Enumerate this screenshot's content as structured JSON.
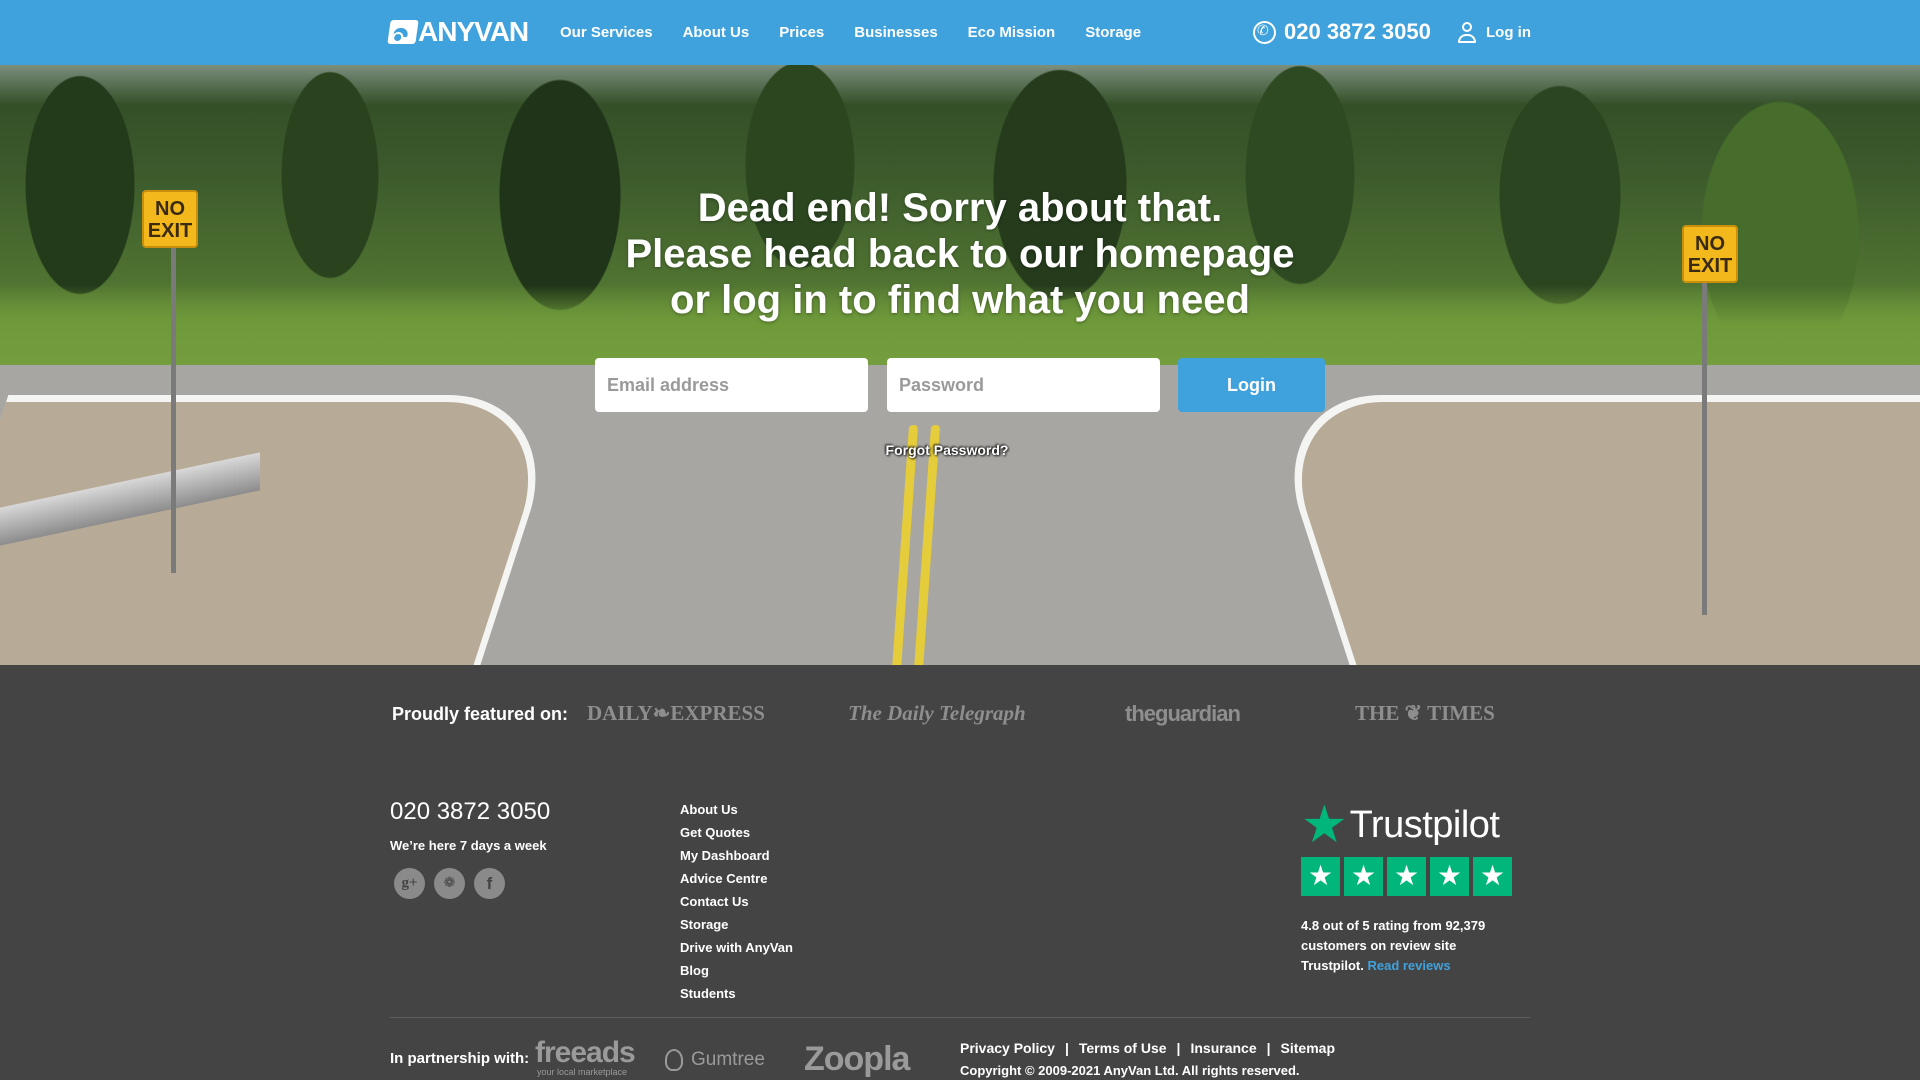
{
  "header": {
    "logo_text": "ANYVAN",
    "nav": [
      {
        "label": "Our Services"
      },
      {
        "label": "About Us"
      },
      {
        "label": "Prices"
      },
      {
        "label": "Businesses"
      },
      {
        "label": "Eco Mission"
      },
      {
        "label": "Storage"
      }
    ],
    "phone": "020 3872 3050",
    "login_label": "Log in",
    "accent_color": "#3fa2dd"
  },
  "hero": {
    "title_lines": [
      "Dead end! Sorry about that.",
      "Please head back to our homepage",
      "or log in to find what you need"
    ],
    "sign_text": [
      "NO",
      "EXIT"
    ],
    "email_placeholder": "Email address",
    "email_value": "",
    "password_placeholder": "Password",
    "password_value": "",
    "login_button": "Login",
    "forgot_password": "Forgot Password?"
  },
  "footer": {
    "featured_label": "Proudly featured on:",
    "press": [
      "DAILY❧EXPRESS",
      "The Daily Telegraph",
      "theguardian",
      "THE ❦ TIMES"
    ],
    "phone": "020 3872 3050",
    "hours": "We’re here 7 days a week",
    "social": [
      {
        "name": "google-plus",
        "glyph": "g+"
      },
      {
        "name": "twitter",
        "glyph": "❁"
      },
      {
        "name": "facebook",
        "glyph": "f"
      }
    ],
    "links": [
      "About Us",
      "Get Quotes",
      "My Dashboard",
      "Advice Centre",
      "Contact Us",
      "Storage",
      "Drive with AnyVan",
      "Blog",
      "Students"
    ],
    "trustpilot": {
      "brand": "Trustpilot",
      "star_glyph": "★",
      "rating": 4.8,
      "rating_out_of": 5,
      "stars_shown": 5,
      "text": "4.8 out of 5 rating from 92,379 customers on review site Trustpilot.",
      "read_reviews": "Read reviews",
      "brand_color": "#00b67a"
    },
    "partner_label": "In partnership with:",
    "partners": {
      "freeads": "freeads",
      "freeads_tagline": "your local marketplace",
      "gumtree": "Gumtree",
      "zoopla": "Zoopla"
    },
    "legal_links": [
      "Privacy Policy",
      "Terms of Use",
      "Insurance",
      "Sitemap"
    ],
    "legal_separator": "|",
    "copyright": "Copyright © 2009-2021 AnyVan Ltd. All rights reserved."
  }
}
